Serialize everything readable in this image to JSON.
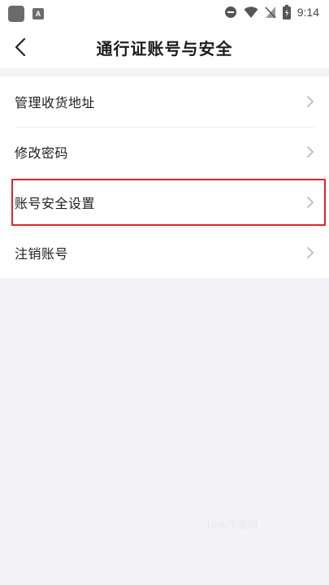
{
  "status_bar": {
    "time": "9:14",
    "notification_icons": [
      "app-icon",
      "font-a-icon"
    ],
    "system_icons": [
      "dnd-icon",
      "wifi-icon",
      "no-sim-icon",
      "battery-icon"
    ]
  },
  "header": {
    "title": "通行证账号与安全",
    "back_icon": "back-icon"
  },
  "menu": {
    "items": [
      {
        "label": "管理收货地址",
        "icon": "chevron-right-icon",
        "highlighted": false
      },
      {
        "label": "修改密码",
        "icon": "chevron-right-icon",
        "highlighted": false
      },
      {
        "label": "账号安全设置",
        "icon": "chevron-right-icon",
        "highlighted": true
      },
      {
        "label": "注销账号",
        "icon": "chevron-right-icon",
        "highlighted": false
      }
    ]
  },
  "colors": {
    "highlight_border": "#d9262c",
    "background": "#f4f3f7",
    "card": "#ffffff"
  },
  "watermark": "Ukiki手游网"
}
